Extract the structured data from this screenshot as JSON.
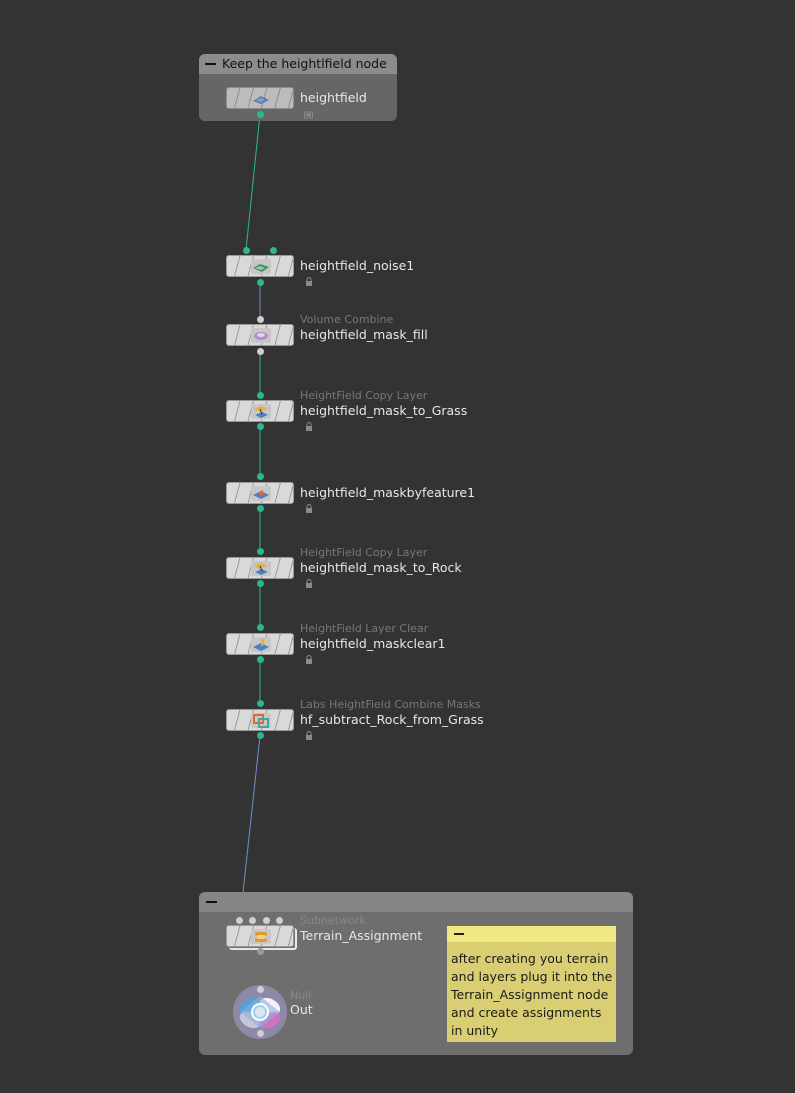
{
  "network_boxes": {
    "top": {
      "title": "Keep the heightlfield node"
    },
    "bottom": {
      "title": ""
    }
  },
  "nodes": {
    "heightfield": {
      "type": "",
      "name": "heightfield"
    },
    "noise": {
      "type": "",
      "name": "heightfield_noise1"
    },
    "mask_fill": {
      "type": "Volume Combine",
      "name": "heightfield_mask_fill"
    },
    "mask_to_grass": {
      "type": "HeightField Copy Layer",
      "name": "heightfield_mask_to_Grass"
    },
    "maskbyfeature": {
      "type": "",
      "name": "heightfield_maskbyfeature1"
    },
    "mask_to_rock": {
      "type": "HeightField Copy Layer",
      "name": "heightfield_mask_to_Rock"
    },
    "maskclear": {
      "type": "HeightField Layer Clear",
      "name": "heightfield_maskclear1"
    },
    "combine_masks": {
      "type": "Labs HeightField Combine Masks",
      "name": "hf_subtract_Rock_from_Grass"
    },
    "terrain_assignment": {
      "type": "Subnetwork",
      "name": "Terrain_Assignment"
    },
    "out": {
      "type": "Null",
      "name": "Out"
    }
  },
  "sticky_note": {
    "text": "after creating you terrain and layers plug it into the Terrain_Assignment node and create assignments in unity"
  },
  "colors": {
    "background": "#333333",
    "netbox_top": "#666666",
    "netbox_top_bar": "#8c8c8c",
    "netbox_bottom": "#6e6e6e",
    "netbox_bottom_bar": "#858585",
    "wire_teal": "#2bb891",
    "wire_blue": "#6f8fc6",
    "sticky_body": "#d9cf72",
    "sticky_bar": "#f1e883"
  }
}
